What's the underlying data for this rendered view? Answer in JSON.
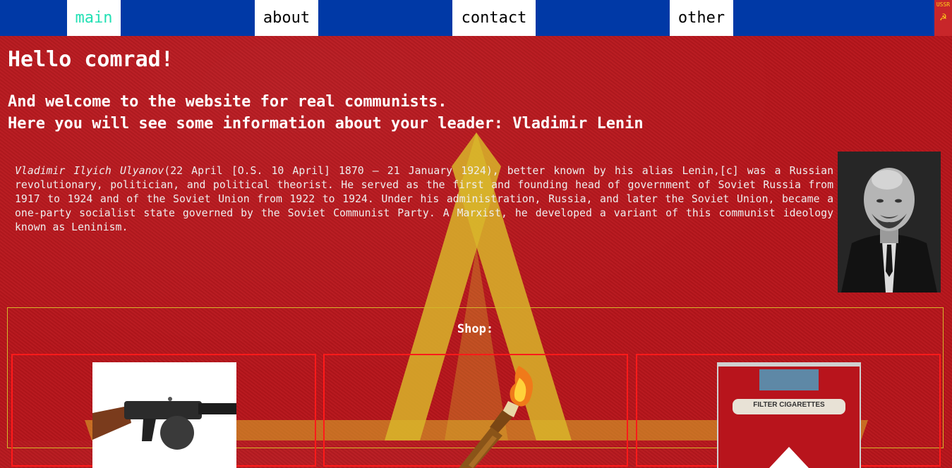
{
  "nav": {
    "items": [
      {
        "label": "main",
        "active": true
      },
      {
        "label": "about",
        "active": false
      },
      {
        "label": "contact",
        "active": false
      },
      {
        "label": "other",
        "active": false
      }
    ],
    "badge_text": "USSR"
  },
  "hero": {
    "title": "Hello comrad!",
    "line1": "And welcome to the website for real communists.",
    "line2": "Here you will see some information about your leader: Vladimir Lenin"
  },
  "bio": {
    "name": "Vladimir Ilyich Ulyanov",
    "text": "(22 April [O.S. 10 April] 1870 – 21 January 1924), better known by his alias Lenin,[c] was a Russian revolutionary, politician, and political theorist. He served as the first and founding head of government of Soviet Russia from 1917 to 1924 and of the Soviet Union from 1922 to 1924. Under his administration, Russia, and later the Soviet Union, became a one-party socialist state governed by the Soviet Communist Party. A Marxist, he developed a variant of this communist ideology known as Leninism."
  },
  "shop": {
    "title": "Shop:",
    "items": [
      {
        "image": "submachine-gun-image"
      },
      {
        "image": "molotov-cocktail-image"
      },
      {
        "image": "cigarettes-pack-image",
        "pack_label": "FILTER CIGARETTES"
      }
    ]
  },
  "colors": {
    "nav_bg": "#0039a6",
    "page_bg": "#b8151c",
    "active_nav_text": "#22e0b4",
    "shop_border": "#d4b72a",
    "card_border": "#ff1a1a",
    "star": "#d8b52a"
  }
}
